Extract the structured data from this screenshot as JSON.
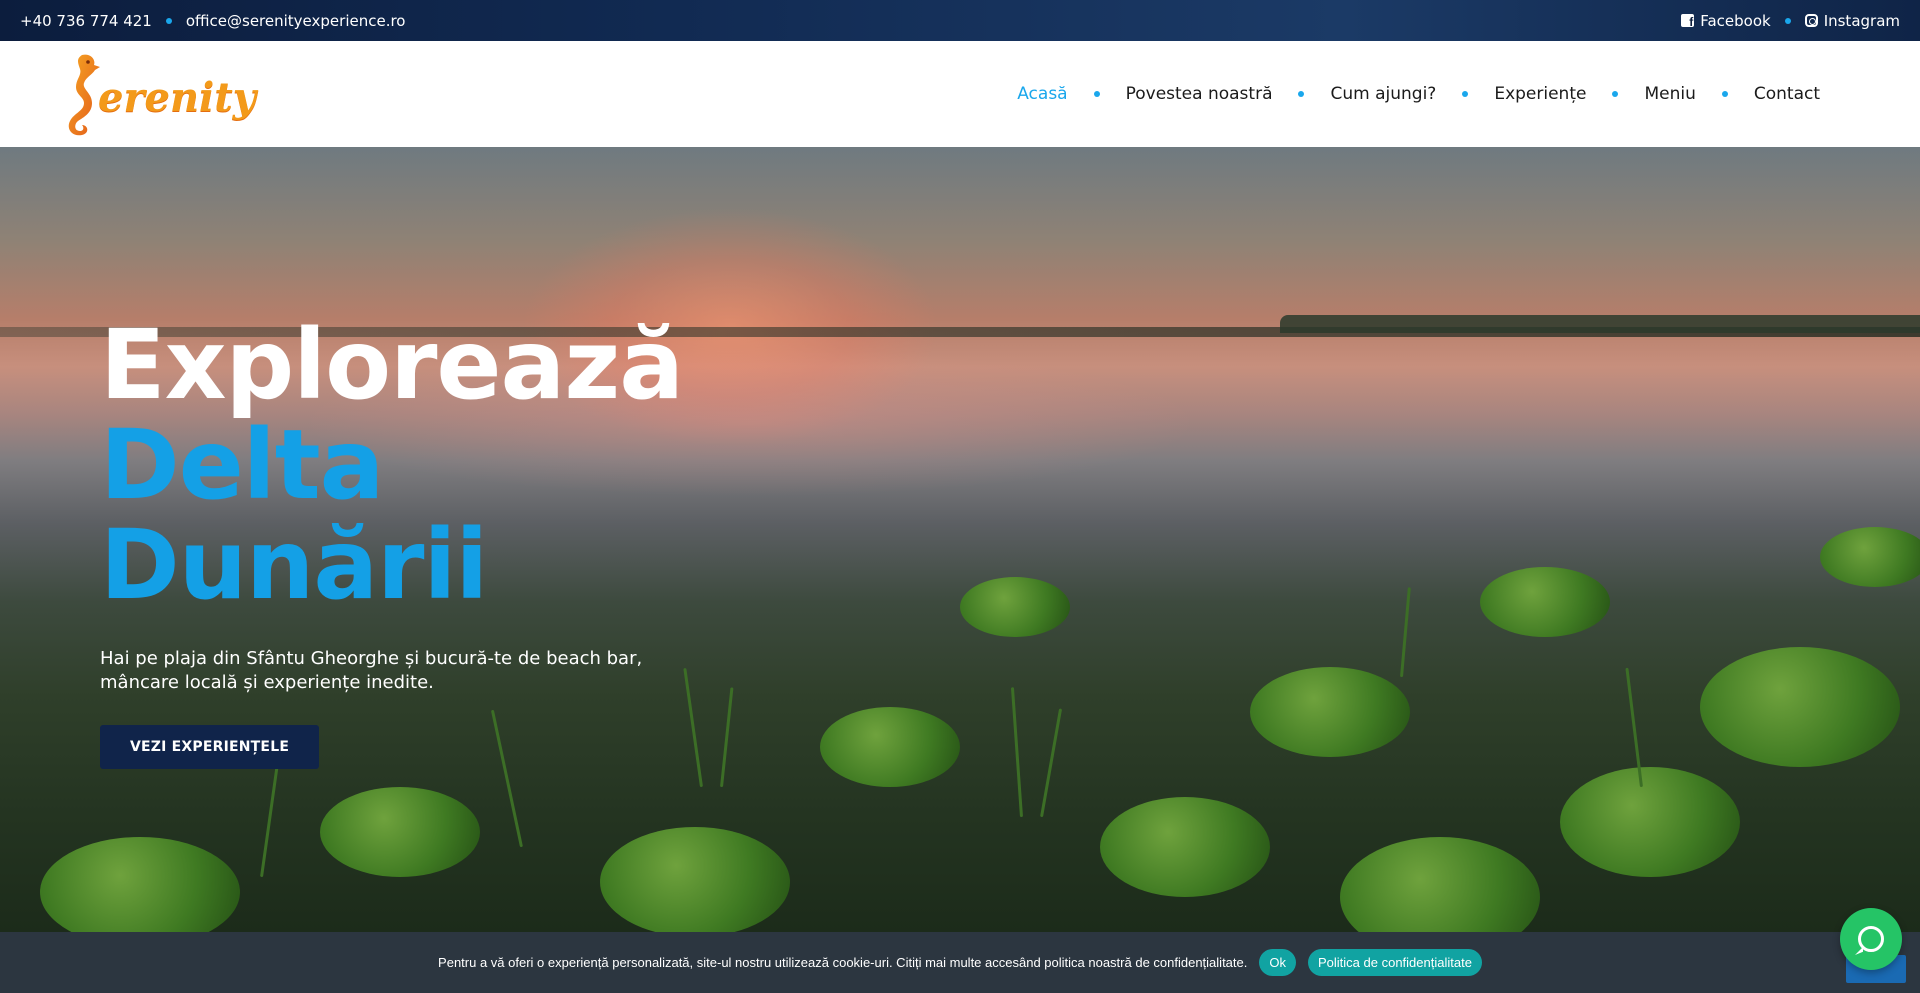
{
  "topbar": {
    "phone": "+40 736 774 421",
    "email": "office@serenityexperience.ro",
    "facebook": "Facebook",
    "instagram": "Instagram",
    "icons": [
      "facebook-icon",
      "instagram-icon"
    ]
  },
  "header": {
    "logo_text": "erenity",
    "nav": {
      "home": "Acasă",
      "story": "Povestea noastră",
      "directions": "Cum ajungi?",
      "experiences": "Experiențe",
      "menu": "Meniu",
      "contact": "Contact"
    }
  },
  "hero": {
    "title_line1": "Explorează",
    "title_line2": "Delta",
    "title_line3": "Dunării",
    "subtitle": "Hai pe plaja din Sfântu Gheorghe și bucură-te de beach bar, mâncare locală și experiențe inedite.",
    "cta": "VEZI EXPERIENȚELE"
  },
  "cookie": {
    "text": "Pentru a vă oferi o experiență personalizată, site-ul nostru utilizează cookie-uri. Citiți mai multe accesând politica noastră de confidențialitate.",
    "ok": "Ok",
    "policy": "Politica de confidențialitate"
  },
  "colors": {
    "accent": "#1aa7ec",
    "dark_navy": "#10244a",
    "logo_orange": "#f39a1a",
    "whatsapp": "#25c466",
    "cookie_teal": "#11a3a2"
  }
}
